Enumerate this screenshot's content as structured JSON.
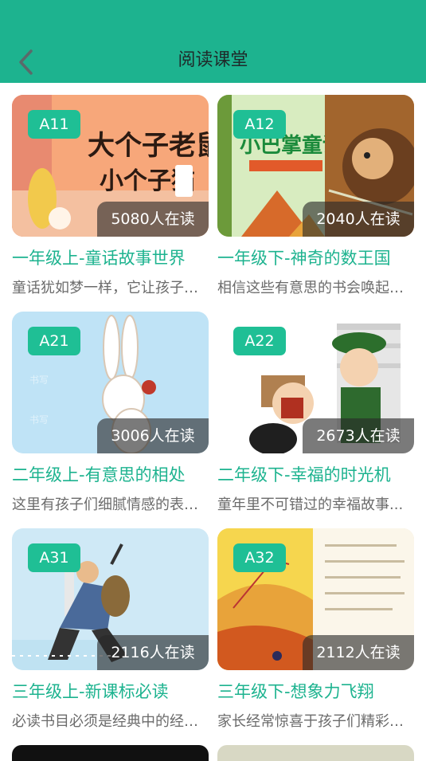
{
  "header": {
    "title": "阅读课堂",
    "back_icon": "chevron-left-icon",
    "background": "#1db38f"
  },
  "courses": [
    {
      "badge": "A11",
      "readers": "5080人在读",
      "title": "一年级上-童话故事世界",
      "desc": "童话犹如梦一样，它让孩子们..."
    },
    {
      "badge": "A12",
      "readers": "2040人在读",
      "title": "一年级下-神奇的数王国",
      "desc": "相信这些有意思的书会唤起孩..."
    },
    {
      "badge": "A21",
      "readers": "3006人在读",
      "title": "二年级上-有意思的相处",
      "desc": "这里有孩子们细腻情感的表达..."
    },
    {
      "badge": "A22",
      "readers": "2673人在读",
      "title": "二年级下-幸福的时光机",
      "desc": "童年里不可错过的幸福故事..."
    },
    {
      "badge": "A31",
      "readers": "2116人在读",
      "title": "三年级上-新课标必读",
      "desc": "必读书目必须是经典中的经典..."
    },
    {
      "badge": "A32",
      "readers": "2112人在读",
      "title": "三年级下-想象力飞翔",
      "desc": "家长经常惊喜于孩子们精彩的..."
    }
  ],
  "colors": {
    "accent": "#1db38f",
    "badge": "#1fbf95"
  }
}
